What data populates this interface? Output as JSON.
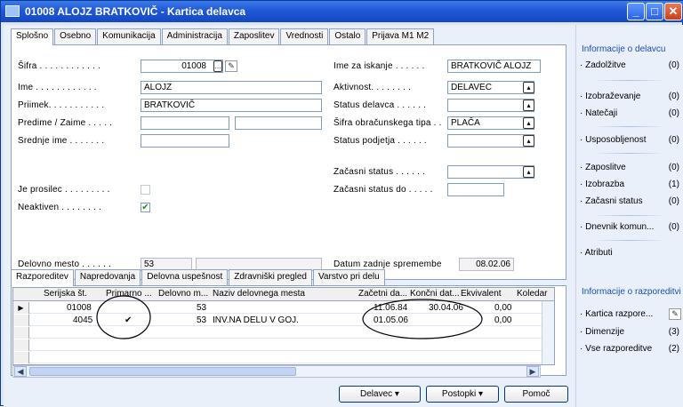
{
  "window": {
    "title": "01008 ALOJZ BRATKOVIČ - Kartica delavca",
    "icon": "card-icon"
  },
  "top_tabs": [
    "Splošno",
    "Osebno",
    "Komunikacija",
    "Administracija",
    "Zaposlitev",
    "Vrednosti",
    "Ostalo",
    "Prijava M1 M2"
  ],
  "form": {
    "sifra_label": "Šifra . . . . . . . . . . . .",
    "sifra_value": "01008",
    "ime_label": "Ime . . . . . . . . . . . .",
    "ime_value": "ALOJZ",
    "priimek_label": "Priimek. . . . . . . . . . .",
    "priimek_value": "BRATKOVIČ",
    "predime_label": "Predime / Zaime . . . . .",
    "predime_value": "",
    "zaime_value": "",
    "srednje_label": "Srednje ime . . . . . . .",
    "srednje_value": "",
    "prosilec_label": "Je prosilec . . . . . . . . .",
    "prosilec_checked": false,
    "neaktiven_label": "Neaktiven . . . . . . . .",
    "neaktiven_checked": true,
    "delovno_label": "Delovno mesto . . . . . .",
    "delovno_value": "53",
    "delovno_name": "",
    "iskanje_label": "Ime za iskanje . . . . . .",
    "iskanje_value": "BRATKOVIČ ALOJZ",
    "aktivnost_label": "Aktivnost. . . . . . . .",
    "aktivnost_value": "DELAVEC",
    "status_label": "Status delavca . . . . . .",
    "status_value": "",
    "obracun_label": "Šifra obračunskega tipa . .",
    "obracun_value": "PLAČA",
    "podjetja_label": "Status podjetja . . . . . .",
    "podjetja_value": "",
    "zacasni_label": "Začasni status . . . . . .",
    "zacasni_value": "",
    "zacasni_do_label": "Začasni status do . . . . .",
    "zacasni_do_value": "",
    "datum_label": "Datum zadnje spremembe",
    "datum_value": "08.02.06"
  },
  "bottom_tabs": [
    "Razporeditev",
    "Napredovanja",
    "Delovna uspešnost",
    "Zdravniški pregled",
    "Varstvo pri delu"
  ],
  "grid": {
    "headers": [
      "Serijska št.",
      "Primarno ...",
      "Delovno m...",
      "Naziv delovnega mesta",
      "Začetni da...",
      "Končni dat...",
      "Ekvivalent",
      "Koledar"
    ],
    "rows": [
      {
        "serijska": "01008",
        "primarno": "",
        "delovno": "53",
        "naziv": "",
        "zacetni": "11.06.84",
        "koncni": "30.04.06",
        "ekvivalent": "0,00"
      },
      {
        "serijska": "4045",
        "primarno": "✔",
        "delovno": "53",
        "naziv": "INV.NA DELU V GOJ.",
        "zacetni": "01.05.06",
        "koncni": "",
        "ekvivalent": "0,00"
      }
    ]
  },
  "buttons": {
    "delavec": "Delavec",
    "postopki": "Postopki",
    "pomoc": "Pomoč"
  },
  "sidebar": {
    "header1": "Informacije o delavcu",
    "items1": [
      {
        "label": "Zadolžitve",
        "count": "(0)"
      },
      {
        "label": "Izobraževanje",
        "count": "(0)"
      },
      {
        "label": "Natečaji",
        "count": "(0)"
      },
      {
        "label": "Usposobljenost",
        "count": "(0)"
      },
      {
        "label": "Zaposlitve",
        "count": "(0)"
      },
      {
        "label": "Izobrazba",
        "count": "(1)"
      },
      {
        "label": "Začasni status",
        "count": "(0)"
      },
      {
        "label": "Dnevnik komun...",
        "count": "(0)"
      },
      {
        "label": "Atributi",
        "count": ""
      }
    ],
    "header2": "Informacije o razporeditvi",
    "items2": [
      {
        "label": "Kartica razpore...",
        "count": ""
      },
      {
        "label": "Dimenzije",
        "count": "(3)"
      },
      {
        "label": "Vse razporeditve",
        "count": "(2)"
      }
    ]
  }
}
